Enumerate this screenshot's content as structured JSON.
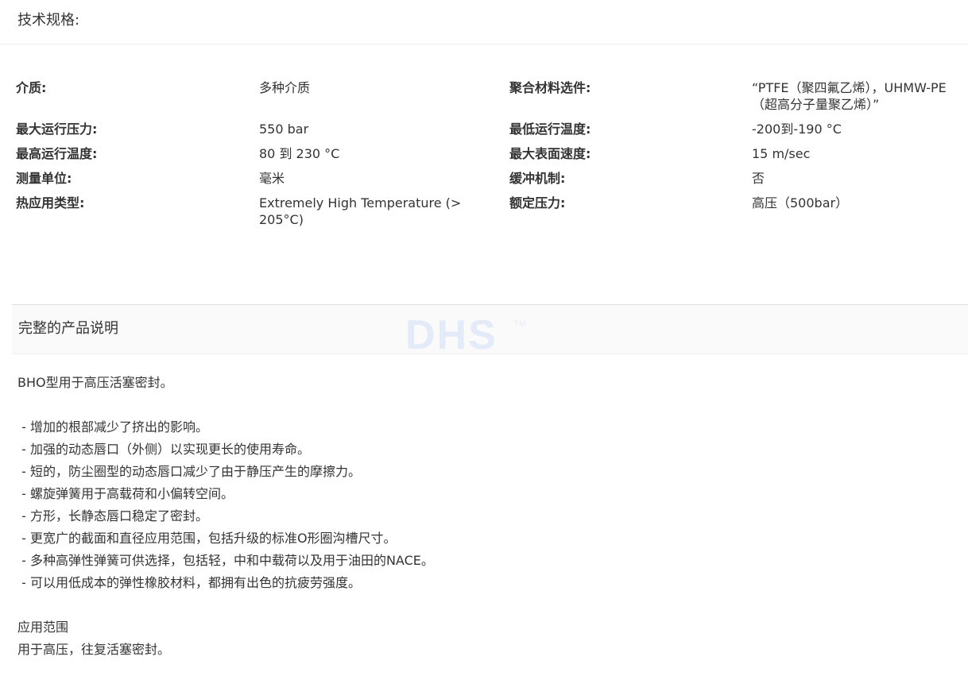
{
  "specs": {
    "title": "技术规格:",
    "rows": [
      {
        "label1": "介质:",
        "value1": "多种介质",
        "label2": "聚合材料选件:",
        "value2": "“PTFE（聚四氟乙烯），UHMW-PE（超高分子量聚乙烯）”"
      },
      {
        "label1": "最大运行压力:",
        "value1": "550 bar",
        "label2": "最低运行温度:",
        "value2": "-200到-190 °C"
      },
      {
        "label1": "最高运行温度:",
        "value1": "80 到 230 °C",
        "label2": "最大表面速度:",
        "value2": "15 m/sec"
      },
      {
        "label1": "测量单位:",
        "value1": "毫米",
        "label2": "缓冲机制:",
        "value2": "否"
      },
      {
        "label1": "热应用类型:",
        "value1": "Extremely High Temperature (> 205°C)",
        "label2": "额定压力:",
        "value2": "高压（500bar）"
      }
    ]
  },
  "description": {
    "title": "完整的产品说明",
    "watermark": "DHS",
    "watermark_tm": "™",
    "intro": "BHO型用于高压活塞密封。",
    "bullets": [
      " - 增加的根部减少了挤出的影响。",
      " - 加强的动态唇口（外侧）以实现更长的使用寿命。",
      " - 短的，防尘圈型的动态唇口减少了由于静压产生的摩擦力。",
      " - 螺旋弹簧用于高载荷和小偏转空间。",
      " - 方形，长静态唇口稳定了密封。",
      " - 更宽广的截面和直径应用范围，包括升级的标准O形圈沟槽尺寸。",
      " - 多种高弹性弹簧可供选择，包括轻，中和中载荷以及用于油田的NACE。",
      " - 可以用低成本的弹性橡胶材料，都拥有出色的抗疲劳强度。"
    ],
    "application_heading": "应用范围",
    "application_text": "用于高压，往复活塞密封。"
  }
}
